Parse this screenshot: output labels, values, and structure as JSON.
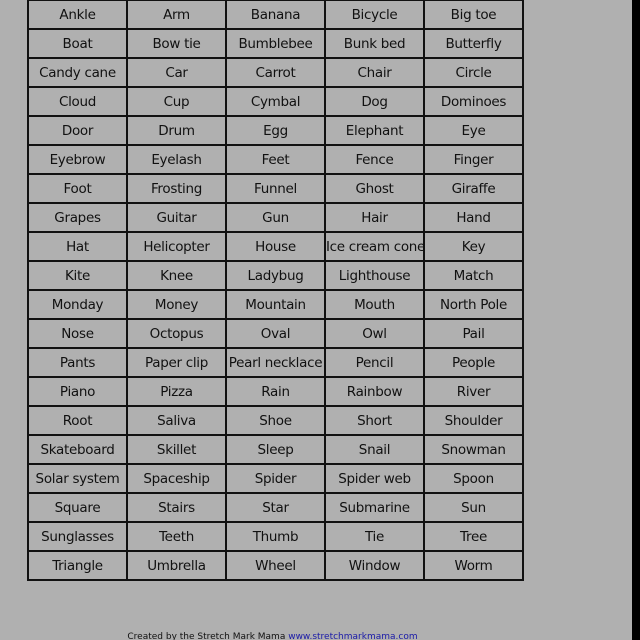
{
  "word_table": {
    "rows": [
      [
        "Ankle",
        "Arm",
        "Banana",
        "Bicycle",
        "Big toe"
      ],
      [
        "Boat",
        "Bow tie",
        "Bumblebee",
        "Bunk bed",
        "Butterfly"
      ],
      [
        "Candy cane",
        "Car",
        "Carrot",
        "Chair",
        "Circle"
      ],
      [
        "Cloud",
        "Cup",
        "Cymbal",
        "Dog",
        "Dominoes"
      ],
      [
        "Door",
        "Drum",
        "Egg",
        "Elephant",
        "Eye"
      ],
      [
        "Eyebrow",
        "Eyelash",
        "Feet",
        "Fence",
        "Finger"
      ],
      [
        "Foot",
        "Frosting",
        "Funnel",
        "Ghost",
        "Giraffe"
      ],
      [
        "Grapes",
        "Guitar",
        "Gun",
        "Hair",
        "Hand"
      ],
      [
        "Hat",
        "Helicopter",
        "House",
        "Ice cream cone",
        "Key"
      ],
      [
        "Kite",
        "Knee",
        "Ladybug",
        "Lighthouse",
        "Match"
      ],
      [
        "Monday",
        "Money",
        "Mountain",
        "Mouth",
        "North Pole"
      ],
      [
        "Nose",
        "Octopus",
        "Oval",
        "Owl",
        "Pail"
      ],
      [
        "Pants",
        "Paper clip",
        "Pearl necklace",
        "Pencil",
        "People"
      ],
      [
        "Piano",
        "Pizza",
        "Rain",
        "Rainbow",
        "River"
      ],
      [
        "Root",
        "Saliva",
        "Shoe",
        "Short",
        "Shoulder"
      ],
      [
        "Skateboard",
        "Skillet",
        "Sleep",
        "Snail",
        "Snowman"
      ],
      [
        "Solar system",
        "Spaceship",
        "Spider",
        "Spider web",
        "Spoon"
      ],
      [
        "Square",
        "Stairs",
        "Star",
        "Submarine",
        "Sun"
      ],
      [
        "Sunglasses",
        "Teeth",
        "Thumb",
        "Tie",
        "Tree"
      ],
      [
        "Triangle",
        "Umbrella",
        "Wheel",
        "Window",
        "Worm"
      ]
    ]
  },
  "footer": {
    "credit_text": "Created by the Stretch Mark Mama ",
    "credit_link": "www.stretchmarkmama.com"
  },
  "colors": {
    "page_background": "#b0b0b0",
    "grid_line": "#111111",
    "link": "#1a1aa8",
    "frame": "#000000"
  }
}
